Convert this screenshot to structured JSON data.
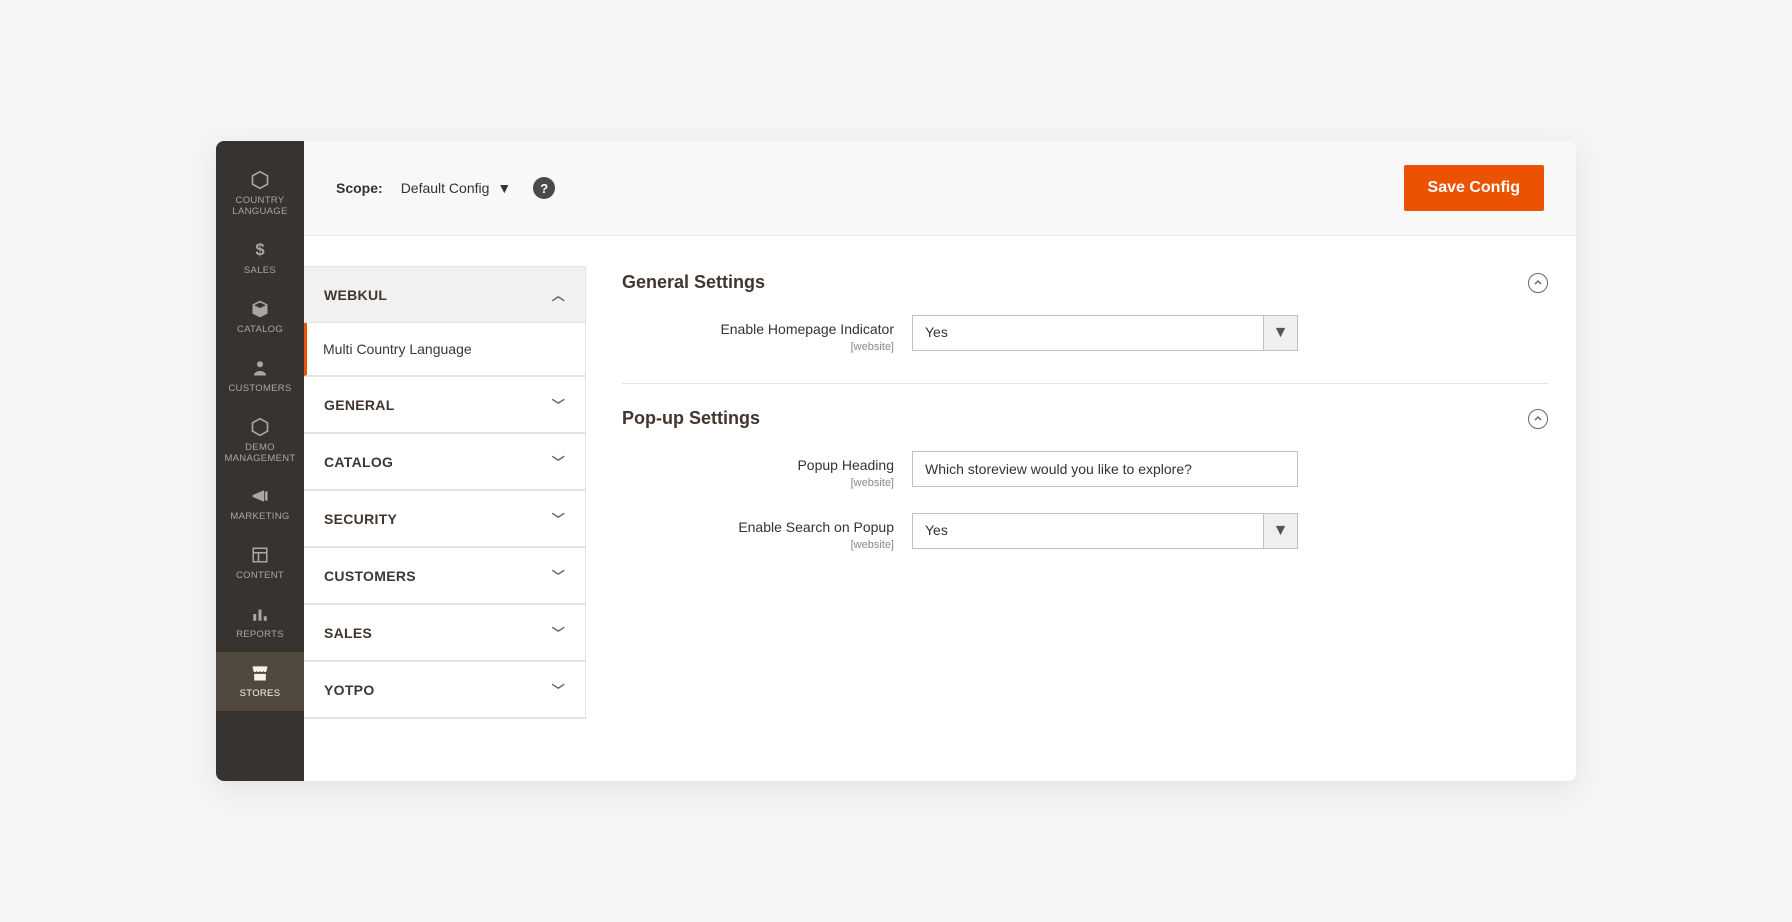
{
  "sidebar": [
    {
      "label": "COUNTRY\nLANGUAGE",
      "icon": "hex"
    },
    {
      "label": "SALES",
      "icon": "dollar"
    },
    {
      "label": "CATALOG",
      "icon": "box"
    },
    {
      "label": "CUSTOMERS",
      "icon": "person"
    },
    {
      "label": "DEMO\nMANAGEMENT",
      "icon": "hex"
    },
    {
      "label": "MARKETING",
      "icon": "megaphone"
    },
    {
      "label": "CONTENT",
      "icon": "layout"
    },
    {
      "label": "REPORTS",
      "icon": "bars"
    },
    {
      "label": "STORES",
      "icon": "storefront",
      "active": true
    }
  ],
  "topbar": {
    "scope_label": "Scope:",
    "scope_value": "Default Config",
    "save_label": "Save Config"
  },
  "config_nav": {
    "expanded_group": "WEBKUL",
    "expanded_subitem": "Multi Country Language",
    "groups": [
      "GENERAL",
      "CATALOG",
      "SECURITY",
      "CUSTOMERS",
      "SALES",
      "YOTPO"
    ]
  },
  "panel": {
    "section1": {
      "title": "General Settings",
      "field1": {
        "label": "Enable Homepage Indicator",
        "scope": "[website]",
        "value": "Yes"
      }
    },
    "section2": {
      "title": "Pop-up Settings",
      "field1": {
        "label": "Popup Heading",
        "scope": "[website]",
        "value": "Which storeview would you like to explore?"
      },
      "field2": {
        "label": "Enable Search on Popup",
        "scope": "[website]",
        "value": "Yes"
      }
    }
  }
}
